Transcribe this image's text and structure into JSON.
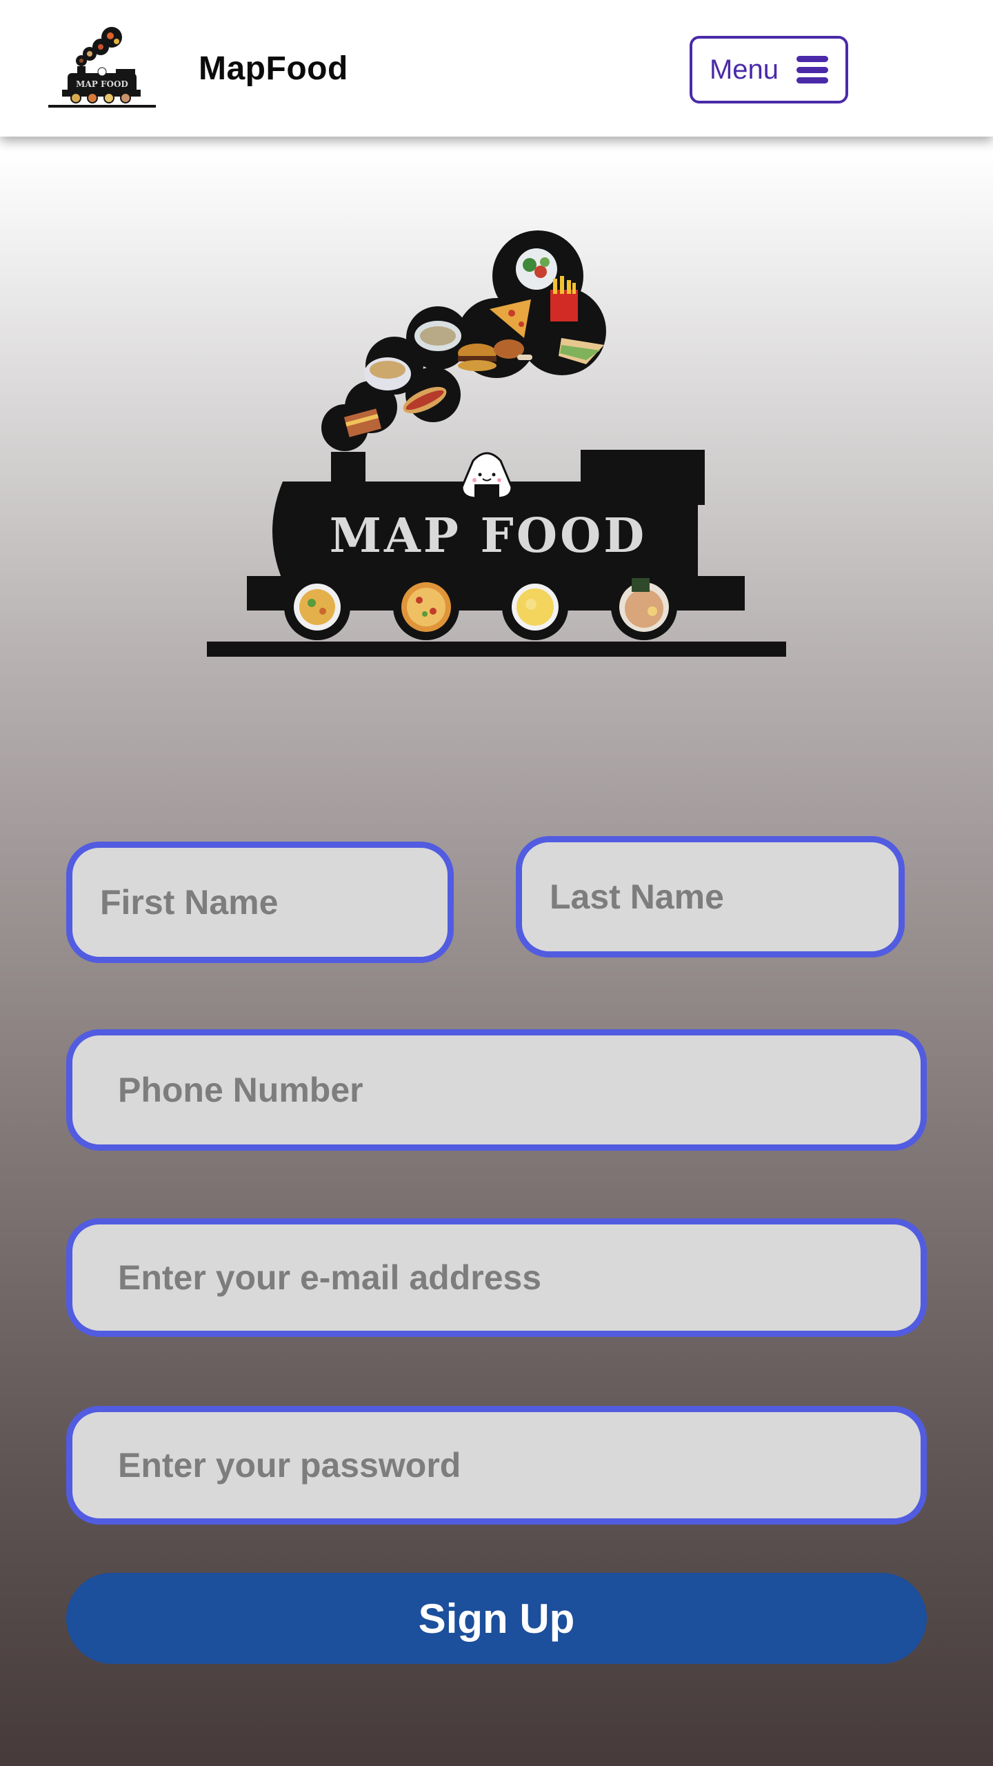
{
  "header": {
    "logo_text": "MAP FOOD",
    "brand_title": "MapFood",
    "menu_label": "Menu",
    "menu_icon": "hamburger-icon"
  },
  "hero": {
    "logo_text": "MAP FOOD"
  },
  "form": {
    "first_name_placeholder": "First Name",
    "last_name_placeholder": "Last Name",
    "phone_placeholder": "Phone Number",
    "email_placeholder": "Enter your e-mail address",
    "password_placeholder": "Enter your password",
    "submit_label": "Sign Up"
  },
  "colors": {
    "accent": "#4a2aa8",
    "field_border": "#525ce0",
    "field_bg": "#d9d9d9",
    "button_bg": "#1c4f9c"
  }
}
